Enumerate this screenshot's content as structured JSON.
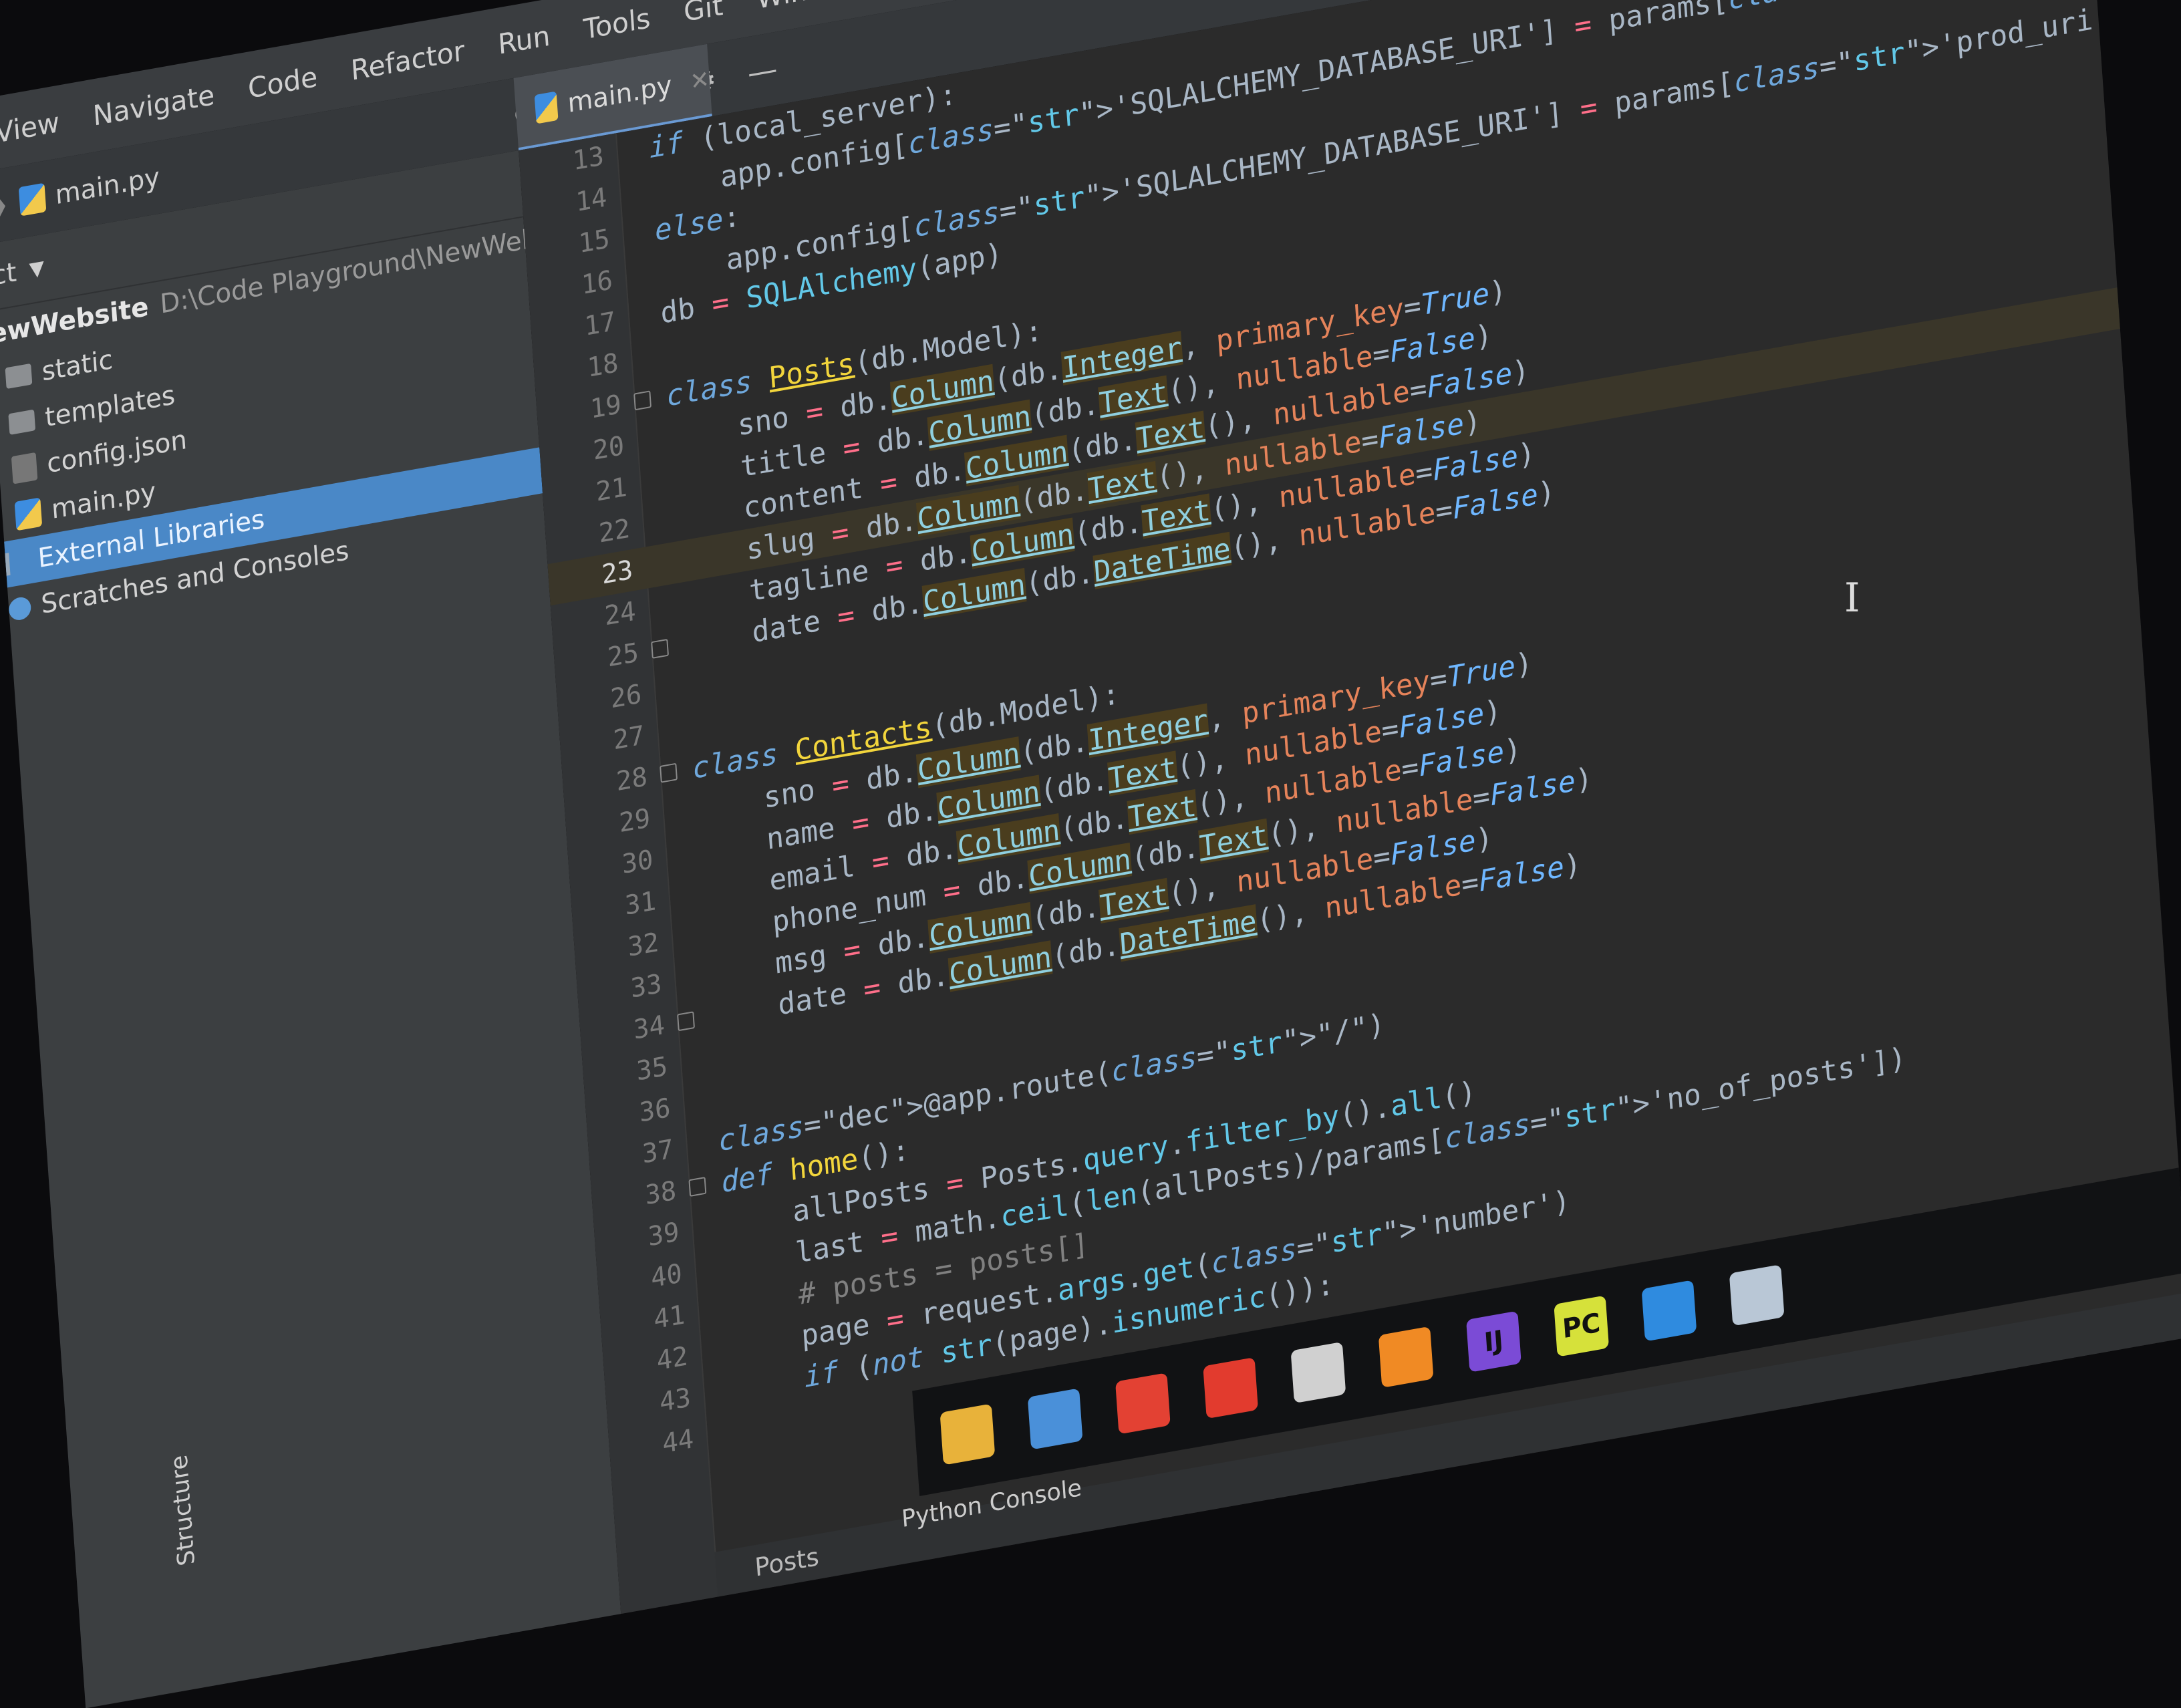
{
  "menubar": {
    "items": [
      "View",
      "Navigate",
      "Code",
      "Refactor",
      "Run",
      "Tools",
      "Git",
      "Windo"
    ]
  },
  "breadcrumb": {
    "file": "main.py"
  },
  "editor_tab": {
    "label": "main.py"
  },
  "project": {
    "header_label": "ct",
    "root_name": "ewWebsite",
    "root_path": "D:\\Code Playground\\NewWebsite",
    "items": [
      {
        "label": "static",
        "icon": "folder-icon"
      },
      {
        "label": "templates",
        "icon": "folder-icon"
      },
      {
        "label": "config.json",
        "icon": "json-file-icon"
      },
      {
        "label": "main.py",
        "icon": "python-file-icon"
      },
      {
        "label": "External Libraries",
        "icon": "library-icon"
      },
      {
        "label": "Scratches and Consoles",
        "icon": "scratches-icon"
      }
    ],
    "selected_label": "External Libraries"
  },
  "side_tab": {
    "structure": "Structure"
  },
  "editor": {
    "current_line": 23,
    "lines": [
      {
        "n": "13",
        "text": "if (local_server):"
      },
      {
        "n": "14",
        "text": "    app.config['SQLALCHEMY_DATABASE_URI'] = params['local_uri']"
      },
      {
        "n": "15",
        "text": "else:"
      },
      {
        "n": "16",
        "text": "    app.config['SQLALCHEMY_DATABASE_URI'] = params['prod_uri']"
      },
      {
        "n": "17",
        "text": "db = SQLAlchemy(app)"
      },
      {
        "n": "18",
        "text": ""
      },
      {
        "n": "19",
        "text": "class Posts(db.Model):"
      },
      {
        "n": "20",
        "text": "    sno = db.Column(db.Integer, primary_key=True)"
      },
      {
        "n": "21",
        "text": "    title = db.Column(db.Text(), nullable=False)"
      },
      {
        "n": "22",
        "text": "    content = db.Column(db.Text(), nullable=False)"
      },
      {
        "n": "23",
        "text": "    slug = db.Column(db.Text(), nullable=False)"
      },
      {
        "n": "24",
        "text": "    tagline = db.Column(db.Text(), nullable=False)"
      },
      {
        "n": "25",
        "text": "    date = db.Column(db.DateTime(), nullable=False)"
      },
      {
        "n": "26",
        "text": ""
      },
      {
        "n": "27",
        "text": ""
      },
      {
        "n": "28",
        "text": "class Contacts(db.Model):"
      },
      {
        "n": "29",
        "text": "    sno = db.Column(db.Integer, primary_key=True)"
      },
      {
        "n": "30",
        "text": "    name = db.Column(db.Text(), nullable=False)"
      },
      {
        "n": "31",
        "text": "    email = db.Column(db.Text(), nullable=False)"
      },
      {
        "n": "32",
        "text": "    phone_num = db.Column(db.Text(), nullable=False)"
      },
      {
        "n": "33",
        "text": "    msg = db.Column(db.Text(), nullable=False)"
      },
      {
        "n": "34",
        "text": "    date = db.Column(db.DateTime(), nullable=False)"
      },
      {
        "n": "35",
        "text": ""
      },
      {
        "n": "36",
        "text": ""
      },
      {
        "n": "37",
        "text": "@app.route(\"/\")"
      },
      {
        "n": "38",
        "text": "def home():"
      },
      {
        "n": "39",
        "text": "    allPosts = Posts.query.filter_by().all()"
      },
      {
        "n": "40",
        "text": "    last = math.ceil(len(allPosts)/params['no_of_posts'])"
      },
      {
        "n": "41",
        "text": "    # posts = posts[]"
      },
      {
        "n": "42",
        "text": "    page = request.args.get('number')"
      },
      {
        "n": "43",
        "text": "    if (not str(page).isnumeric()):"
      },
      {
        "n": "44",
        "text": ""
      }
    ],
    "footer_breadcrumb": "Posts"
  },
  "bottom": {
    "python_console": "Python Console"
  },
  "taskbar": {
    "apps": [
      {
        "name": "file-explorer-icon",
        "glyph": "",
        "color": "#e8b23a"
      },
      {
        "name": "this-pc-icon",
        "glyph": "",
        "color": "#4a90d9"
      },
      {
        "name": "chrome-icon",
        "glyph": "",
        "color": "#e34133"
      },
      {
        "name": "record-icon",
        "glyph": "",
        "color": "#e23b2e"
      },
      {
        "name": "obs-icon",
        "glyph": "",
        "color": "#d0d0d0"
      },
      {
        "name": "sublime-text-icon",
        "glyph": "",
        "color": "#f08a24"
      },
      {
        "name": "intellij-icon",
        "glyph": "IJ",
        "color": "#7b4bd6"
      },
      {
        "name": "pycharm-icon",
        "glyph": "PC",
        "color": "#d6e13a"
      },
      {
        "name": "vscode-icon",
        "glyph": "",
        "color": "#2f8bdf"
      },
      {
        "name": "snip-tool-icon",
        "glyph": "",
        "color": "#b9c7d6"
      }
    ]
  }
}
